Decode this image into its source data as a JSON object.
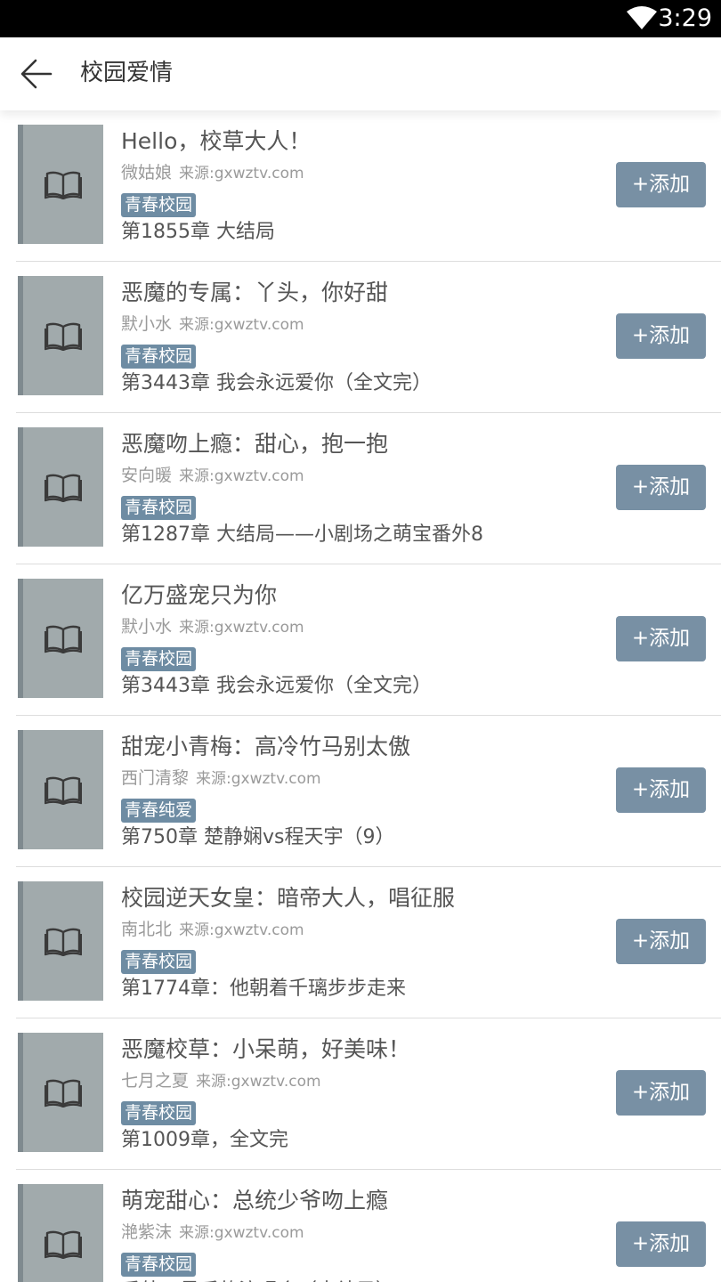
{
  "status_bar": {
    "time": "3:29"
  },
  "header": {
    "title": "校园爱情"
  },
  "books": [
    {
      "title": "Hello，校草大人！",
      "author": "微姑娘",
      "source": "来源:gxwztv.com",
      "tag": "青春校园",
      "chapter": "第1855章 大结局",
      "button": "+添加"
    },
    {
      "title": "恶魔的专属：丫头，你好甜",
      "author": "默小水",
      "source": "来源:gxwztv.com",
      "tag": "青春校园",
      "chapter": "第3443章 我会永远爱你（全文完）",
      "button": "+添加"
    },
    {
      "title": "恶魔吻上瘾：甜心，抱一抱",
      "author": "安向暖",
      "source": "来源:gxwztv.com",
      "tag": "青春校园",
      "chapter": "第1287章 大结局——小剧场之萌宝番外8",
      "button": "+添加"
    },
    {
      "title": "亿万盛宠只为你",
      "author": "默小水",
      "source": "来源:gxwztv.com",
      "tag": "青春校园",
      "chapter": "第3443章 我会永远爱你（全文完）",
      "button": "+添加"
    },
    {
      "title": "甜宠小青梅：高冷竹马别太傲",
      "author": "西门清黎",
      "source": "来源:gxwztv.com",
      "tag": "青春纯爱",
      "chapter": "第750章 楚静娴vs程天宇（9）",
      "button": "+添加"
    },
    {
      "title": "校园逆天女皇：暗帝大人，唱征服",
      "author": "南北北",
      "source": "来源:gxwztv.com",
      "tag": "青春校园",
      "chapter": "第1774章：他朝着千璃步步走来",
      "button": "+添加"
    },
    {
      "title": "恶魔校草：小呆萌，好美味！",
      "author": "七月之夏",
      "source": "来源:gxwztv.com",
      "tag": "青春校园",
      "chapter": "第1009章，全文完",
      "button": "+添加"
    },
    {
      "title": "萌宠甜心：总统少爷吻上瘾",
      "author": "滟紫沫",
      "source": "来源:gxwztv.com",
      "tag": "青春校园",
      "chapter": "番外：最后的演唱会（大结局）",
      "button": "+添加"
    }
  ],
  "icons": {
    "back": "arrow-left-icon",
    "wifi": "wifi-icon",
    "cover": "book-icon"
  },
  "colors": {
    "tag_bg": "#6e8ca3",
    "button_bg": "#7890a4",
    "cover_bg": "#a1aaac"
  }
}
